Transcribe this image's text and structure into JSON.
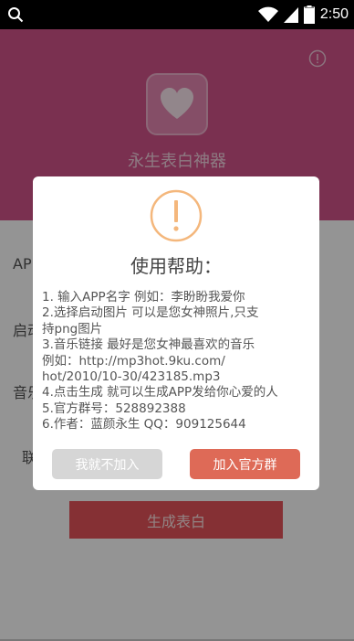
{
  "status_bar": {
    "time": "2:50",
    "icons": [
      "search-icon",
      "wifi-icon",
      "signal-icon",
      "battery-icon"
    ]
  },
  "header": {
    "app_title": "永生表白神器",
    "info_icon": "info-icon",
    "logo_icon": "heart-icon"
  },
  "form": {
    "labels": [
      "APP",
      "启动",
      "音乐",
      "联"
    ],
    "generate_button": "生成表白"
  },
  "dialog": {
    "icon": "warning-icon",
    "title": "使用帮助：",
    "lines": [
      "1. 输入APP名字 例如：李盼盼我爱你",
      "2.选择启动图片 可以是您女神照片,只支",
      "持png图片",
      "3.音乐链接 最好是您女神最喜欢的音乐",
      "例如：http://mp3hot.9ku.com/",
      "hot/2010/10-30/423185.mp3",
      "4.点击生成 就可以生成APP发给你心爱的人",
      "5.官方群号：528892388",
      "6.作者：蓝颜永生 QQ：909125644"
    ],
    "decline_button": "我就不加入",
    "join_button": "加入官方群"
  },
  "colors": {
    "header_pink": "#d3538a",
    "primary_red": "#e6535a",
    "join_orange": "#de6a57",
    "warn_orange": "#f4b77c"
  }
}
